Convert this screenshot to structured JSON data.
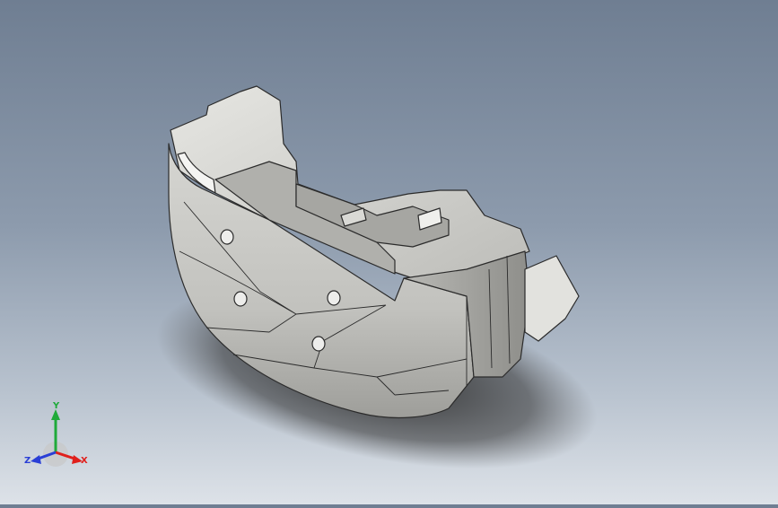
{
  "viewport": {
    "background_top": "#6f7e92",
    "background_bottom": "#dde2e8",
    "model_fill": "#c6c6c2",
    "model_shade": "#9a9a96",
    "model_edge": "#2b2b2b"
  },
  "triad": {
    "x_label": "X",
    "y_label": "Y",
    "z_label": "Z",
    "x_color": "#e0201c",
    "y_color": "#1faa3a",
    "z_color": "#2a3fd6"
  }
}
